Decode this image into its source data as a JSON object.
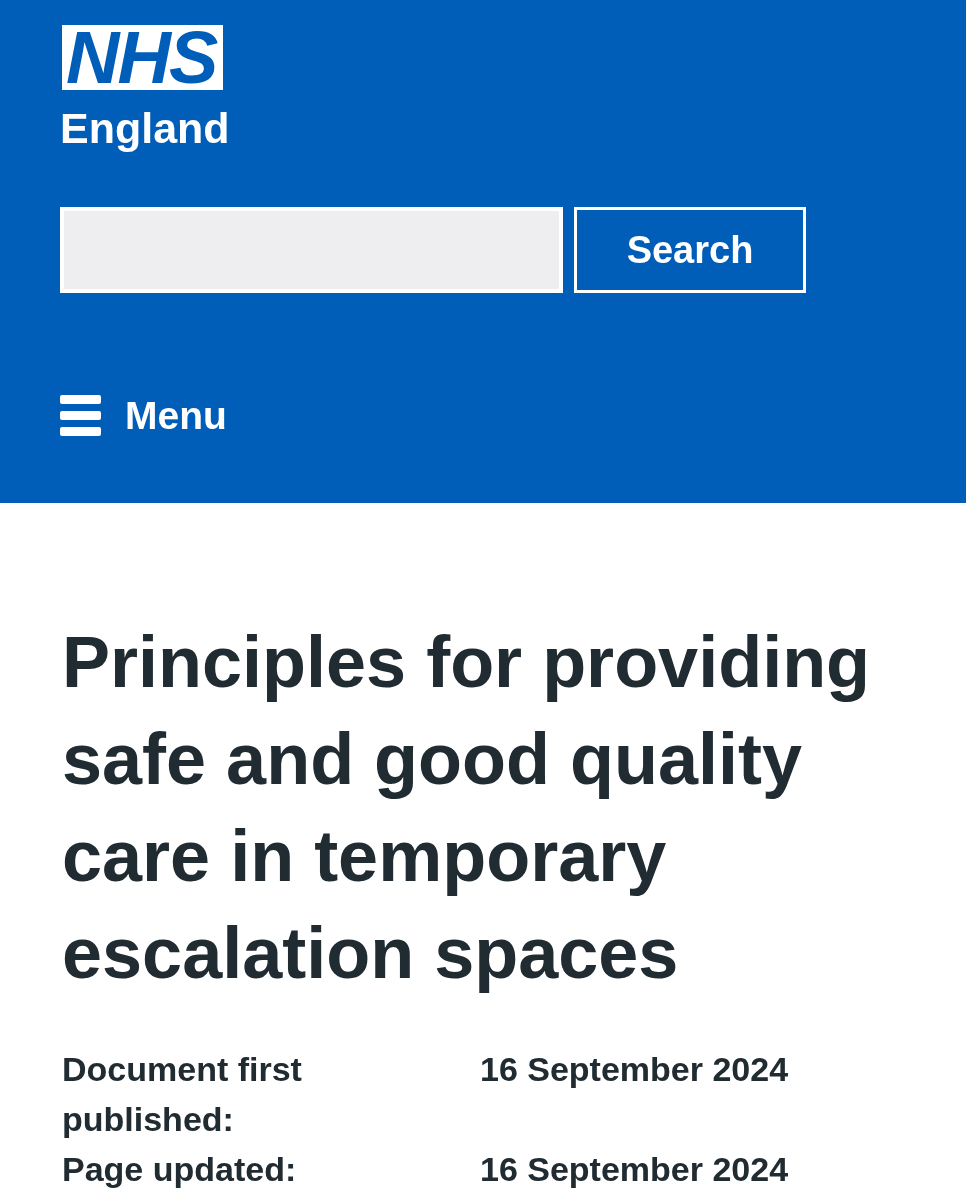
{
  "header": {
    "logo": {
      "mark": "NHS",
      "name": "England"
    },
    "search": {
      "button": "Search"
    },
    "menu": {
      "label": "Menu"
    }
  },
  "page": {
    "title": "Principles for providing safe and good quality care in temporary escalation spaces",
    "meta": [
      {
        "label": "Document first published:",
        "value": "16 September 2024"
      },
      {
        "label": "Page updated:",
        "value": "16 September 2024"
      }
    ]
  }
}
